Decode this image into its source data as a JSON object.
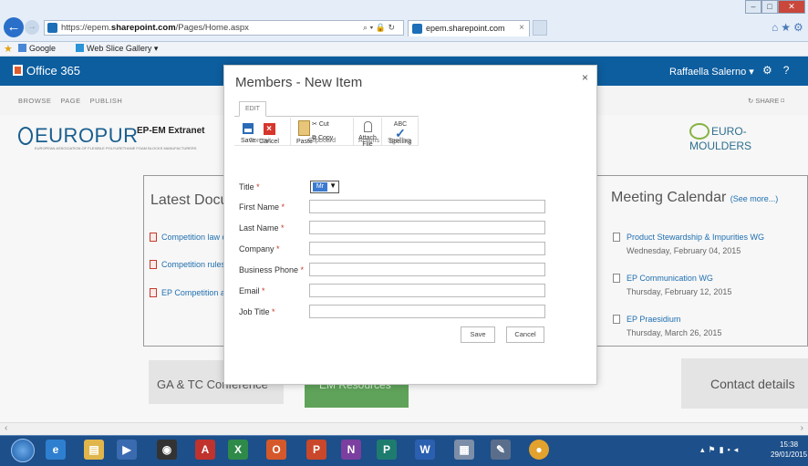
{
  "browser": {
    "url_prefix": "https://epem.",
    "url_domain": "sharepoint.com",
    "url_path": "/Pages/Home.aspx",
    "addr_tools": "⌕ ▾ 🔒 ↻",
    "tab_title": "epem.sharepoint.com",
    "tab_close": "×",
    "fav_google": "Google",
    "fav_webslice": "Web Slice Gallery ▾"
  },
  "suite": {
    "brand": "Office 365",
    "user": "Raffaella Salerno",
    "user_chevron": "▾"
  },
  "ribbon_tabs": [
    "BROWSE",
    "PAGE",
    "PUBLISH"
  ],
  "share_label": "SHARE",
  "site": {
    "logo_left": "EUROPUR",
    "logo_left_sub": "EUROPEAN ASSOCIATION OF FLEXIBLE POLYURETHANE FOAM BLOCKS MANUFACTURERS",
    "title": "EP-EM Extranet",
    "logo_right": "EURO-MOULDERS"
  },
  "latest_docs": {
    "title": "Latest Docu",
    "items": [
      "Competition law c",
      "Competition rules",
      "EP Competition ar"
    ]
  },
  "meeting_calendar": {
    "title": "Meeting Calendar",
    "see_more": "(See more...)",
    "events": [
      {
        "title": "Product Stewardship & Impurities WG",
        "date": "Wednesday, February 04, 2015"
      },
      {
        "title": "EP Communication WG",
        "date": "Thursday, February 12, 2015"
      },
      {
        "title": "EP Praesidium",
        "date": "Thursday, March 26, 2015"
      }
    ]
  },
  "tiles": {
    "ga": "GA & TC Conference",
    "green": "EM Resources",
    "contact": "Contact details"
  },
  "dialog": {
    "title": "Members - New Item",
    "close": "×",
    "edit_tab": "EDIT",
    "ribbon": {
      "save": "Save",
      "cancel": "Cancel",
      "paste": "Paste",
      "cut": "Cut",
      "copy": "Copy",
      "attach": "Attach File",
      "spelling_abc": "ABC",
      "spelling": "Spelling",
      "group_commit": "Commit",
      "group_clipboard": "Clipboard",
      "group_actions": "Actions",
      "group_spelling": "Spelling"
    },
    "fields": {
      "title": "Title",
      "title_value": "Mr",
      "first_name": "First Name",
      "last_name": "Last Name",
      "company": "Company",
      "business_phone": "Business Phone",
      "email": "Email",
      "job_title": "Job Title",
      "required_mark": " *"
    },
    "save_button": "Save",
    "cancel_button": "Cancel"
  },
  "taskbar": {
    "time": "15:38",
    "date": "29/01/2015"
  },
  "colors": {
    "suite_bar": "#0d5e9f",
    "taskbar": "#1d4f8a",
    "link": "#1f6fb0",
    "required": "#c43a2a"
  }
}
